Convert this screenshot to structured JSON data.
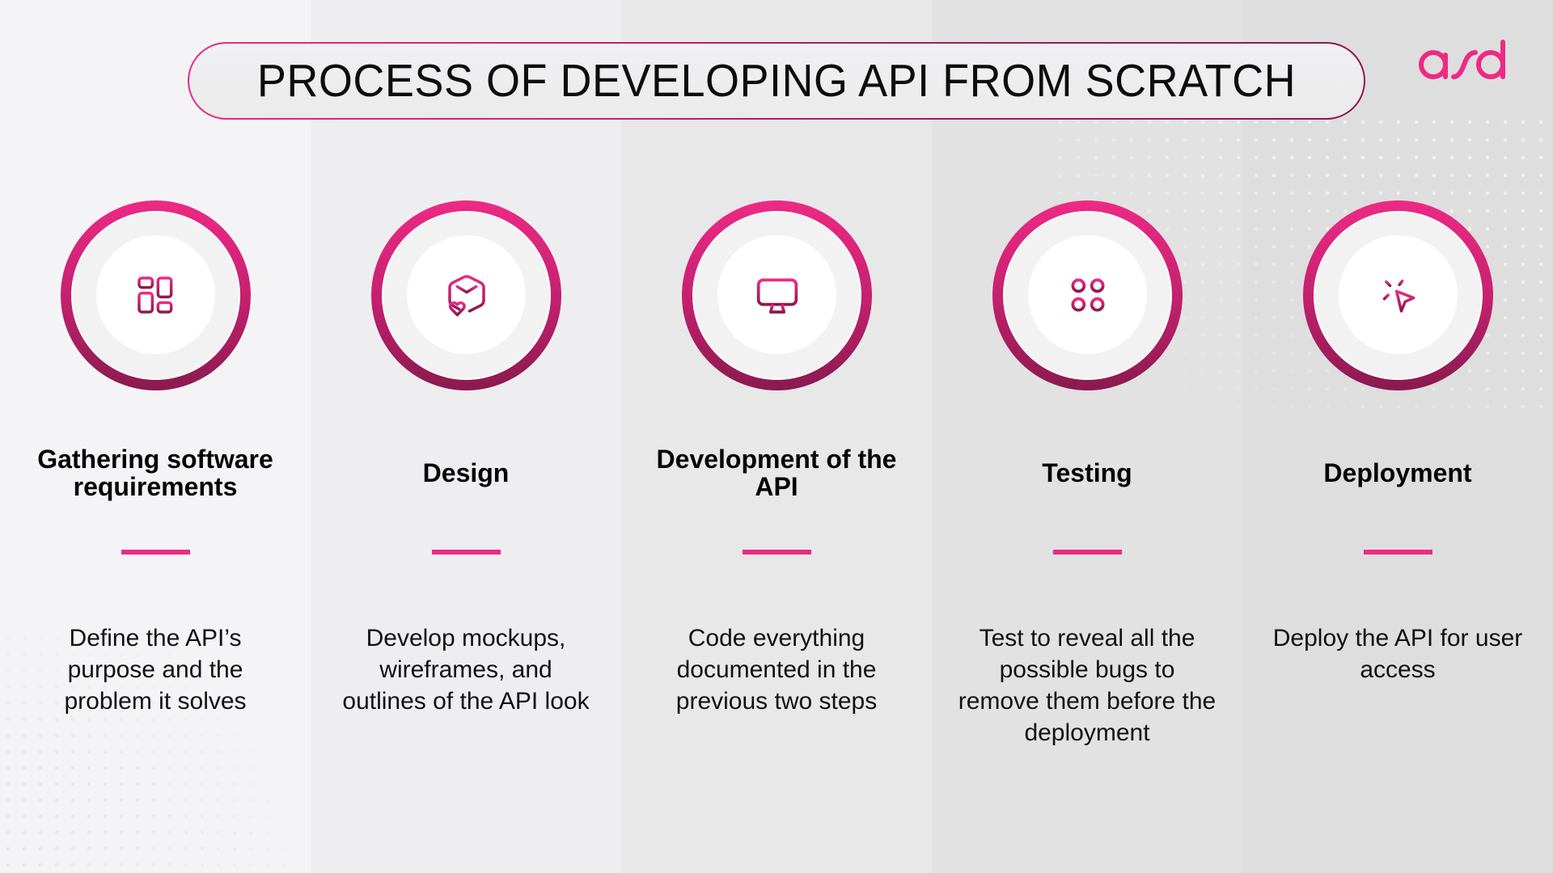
{
  "title": "PROCESS OF DEVELOPING API FROM SCRATCH",
  "logo": {
    "text": "asd",
    "color": "#ed2a85"
  },
  "colors": {
    "accent": "#ed2a85",
    "accent_dark": "#8a1a4e"
  },
  "steps": [
    {
      "icon": "dashboard-grid-icon",
      "heading": "Gathering software requirements",
      "description": "Define the API’s purpose and the problem it solves"
    },
    {
      "icon": "box-heart-icon",
      "heading": "Design",
      "description": "Develop mockups, wireframes, and outlines of the API look"
    },
    {
      "icon": "monitor-icon",
      "heading": "Development of the API",
      "description": "Code everything documented in the previous two steps"
    },
    {
      "icon": "four-circles-icon",
      "heading": "Testing",
      "description": "Test to reveal all the possible bugs to remove them before the deployment"
    },
    {
      "icon": "cursor-click-icon",
      "heading": "Deployment",
      "description": "Deploy the API for user access"
    }
  ]
}
